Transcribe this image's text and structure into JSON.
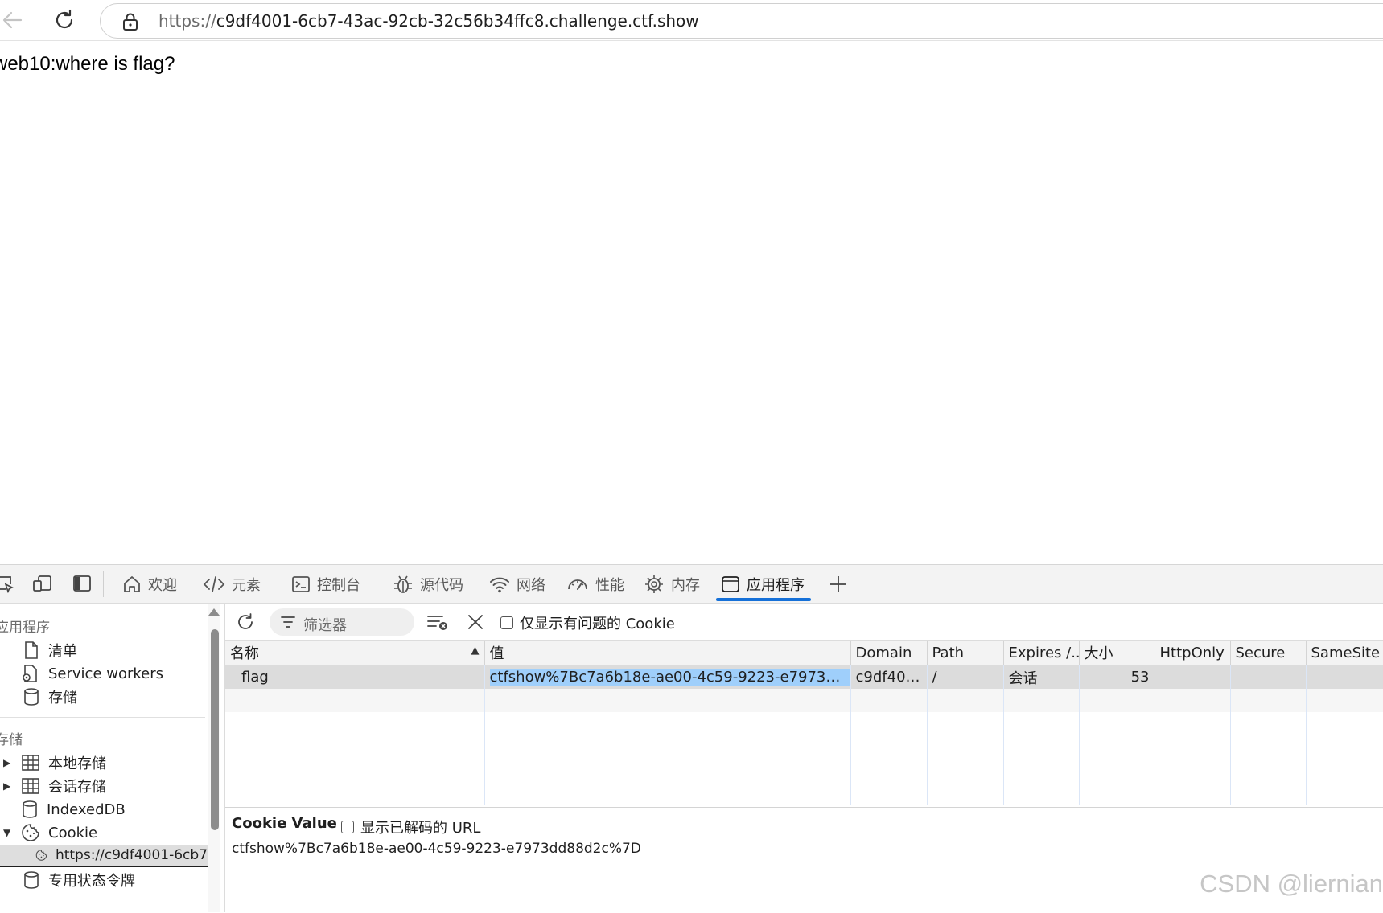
{
  "browser": {
    "url_scheme": "https://",
    "url_host": "c9df4001-6cb7-43ac-92cb-32c56b34ffc8.challenge.ctf.show"
  },
  "page": {
    "heading": "web10:where is flag?"
  },
  "devtools": {
    "tabs": [
      {
        "label": "欢迎",
        "icon": "home-icon"
      },
      {
        "label": "元素",
        "icon": "code-icon"
      },
      {
        "label": "控制台",
        "icon": "console-icon"
      },
      {
        "label": "源代码",
        "icon": "bug-icon"
      },
      {
        "label": "网络",
        "icon": "wifi-icon"
      },
      {
        "label": "性能",
        "icon": "gauge-icon"
      },
      {
        "label": "内存",
        "icon": "chip-icon"
      },
      {
        "label": "应用程序",
        "icon": "app-window-icon",
        "active": true
      }
    ],
    "sidebar": {
      "section_app": "应用程序",
      "app_items": [
        "清单",
        "Service workers",
        "存储"
      ],
      "section_storage": "存储",
      "storage_items": [
        "本地存储",
        "会话存储",
        "IndexedDB",
        "Cookie"
      ],
      "cookie_origin": "https://c9df4001-6cb7",
      "trust_tokens": "专用状态令牌"
    },
    "toolbar": {
      "filter_placeholder": "筛选器",
      "only_issues_label": "仅显示有问题的 Cookie"
    },
    "table": {
      "columns": [
        "名称",
        "值",
        "Domain",
        "Path",
        "Expires /...",
        "大小",
        "HttpOnly",
        "Secure",
        "SameSite"
      ],
      "rows": [
        {
          "name": "flag",
          "value": "ctfshow%7Bc7a6b18e-ae00-4c59-9223-e7973dd88d2...",
          "domain": "c9df400...",
          "path": "/",
          "expires": "会话",
          "size": "53",
          "httponly": "",
          "secure": "",
          "samesite": ""
        }
      ]
    },
    "value_pane": {
      "title": "Cookie Value",
      "decoded_label": "显示已解码的 URL",
      "value": "ctfshow%7Bc7a6b18e-ae00-4c59-9223-e7973dd88d2c%7D"
    }
  },
  "watermark": "CSDN @liernian",
  "colors": {
    "accent": "#1570d8",
    "selection": "#9fcffb"
  }
}
